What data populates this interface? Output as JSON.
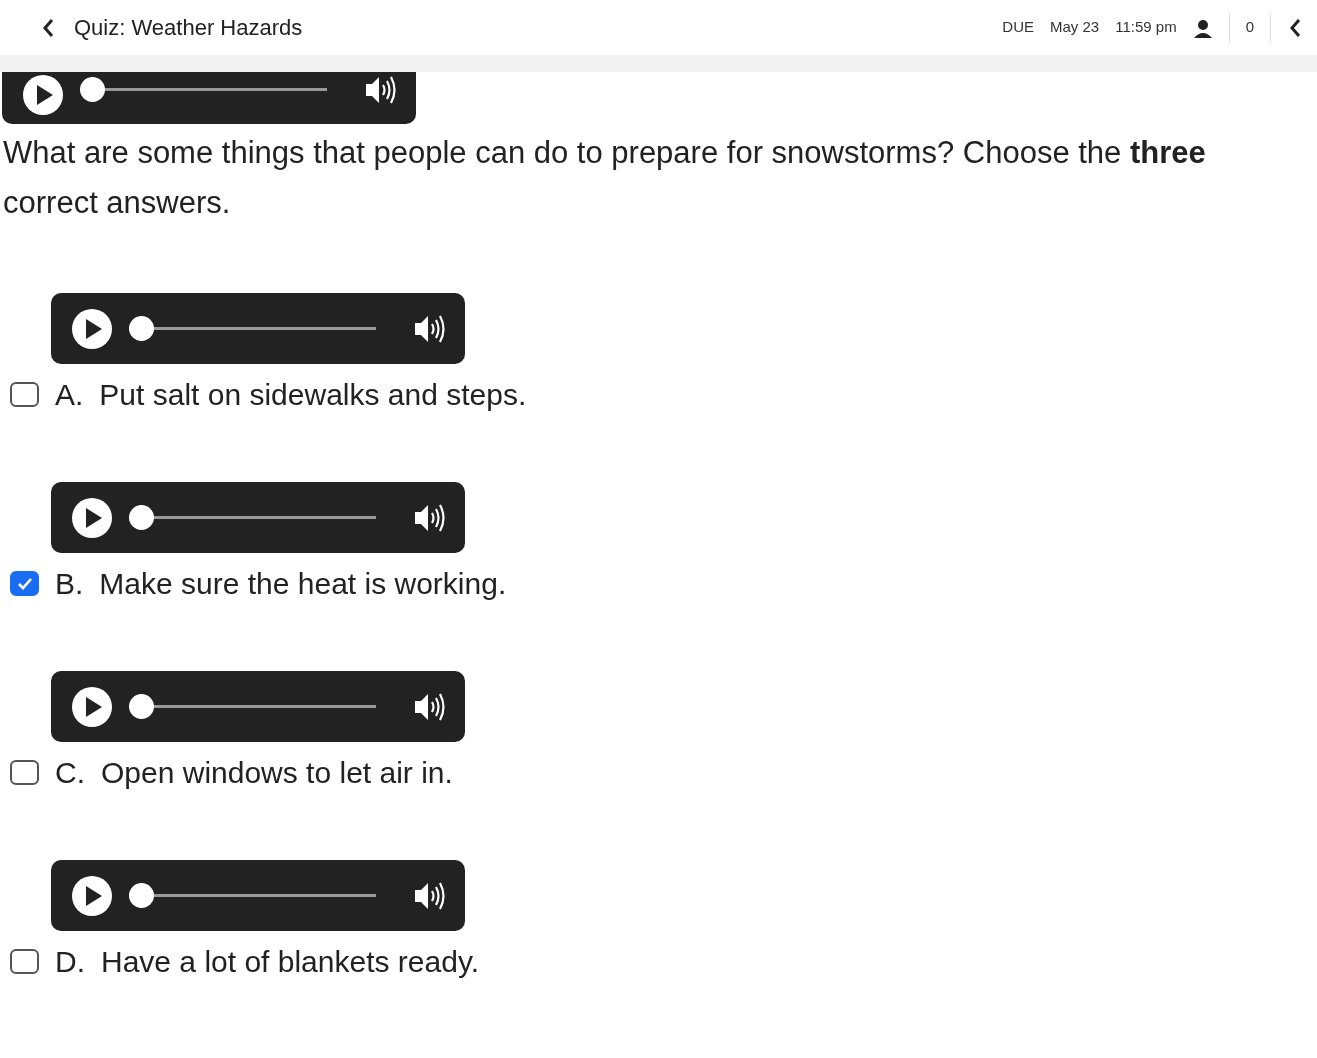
{
  "header": {
    "title": "Quiz: Weather Hazards",
    "due_label": "DUE",
    "due_date": "May 23",
    "due_time": "11:59 pm",
    "count": "0"
  },
  "question": {
    "audio": {
      "level": 0
    },
    "text": "What are some things that people can do to prepare for snowstorms? Choose the **three** correct answers."
  },
  "options": [
    {
      "letter": "A.",
      "text": "Put salt on sidewalks and steps.",
      "checked": false,
      "audio": {
        "level": 0
      }
    },
    {
      "letter": "B.",
      "text": "Make sure the heat is working.",
      "checked": true,
      "audio": {
        "level": 0
      }
    },
    {
      "letter": "C.",
      "text": "Open windows to let air in.",
      "checked": false,
      "audio": {
        "level": 0
      }
    },
    {
      "letter": "D.",
      "text": "Have a lot of blankets ready.",
      "checked": false,
      "audio": {
        "level": 0
      }
    }
  ]
}
